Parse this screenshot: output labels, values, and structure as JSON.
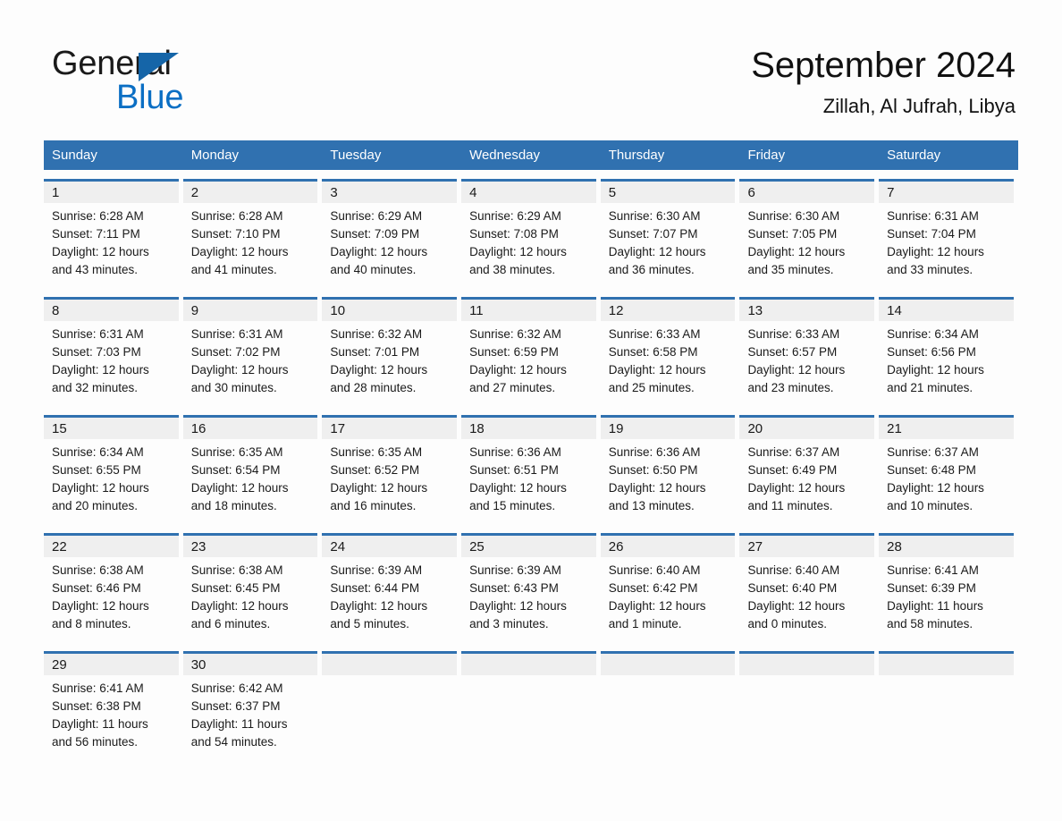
{
  "logo": {
    "word_general": "General",
    "word_blue": "Blue",
    "triangle_color": "#1565a8",
    "blue_text_color": "#0b6fc4"
  },
  "header": {
    "month_title": "September 2024",
    "location": "Zillah, Al Jufrah, Libya",
    "header_bg_color": "#3071b0",
    "day_band_color": "#efefef"
  },
  "weekdays": [
    "Sunday",
    "Monday",
    "Tuesday",
    "Wednesday",
    "Thursday",
    "Friday",
    "Saturday"
  ],
  "weeks": [
    [
      {
        "day": "1",
        "sunrise": "Sunrise: 6:28 AM",
        "sunset": "Sunset: 7:11 PM",
        "daylight_1": "Daylight: 12 hours",
        "daylight_2": "and 43 minutes."
      },
      {
        "day": "2",
        "sunrise": "Sunrise: 6:28 AM",
        "sunset": "Sunset: 7:10 PM",
        "daylight_1": "Daylight: 12 hours",
        "daylight_2": "and 41 minutes."
      },
      {
        "day": "3",
        "sunrise": "Sunrise: 6:29 AM",
        "sunset": "Sunset: 7:09 PM",
        "daylight_1": "Daylight: 12 hours",
        "daylight_2": "and 40 minutes."
      },
      {
        "day": "4",
        "sunrise": "Sunrise: 6:29 AM",
        "sunset": "Sunset: 7:08 PM",
        "daylight_1": "Daylight: 12 hours",
        "daylight_2": "and 38 minutes."
      },
      {
        "day": "5",
        "sunrise": "Sunrise: 6:30 AM",
        "sunset": "Sunset: 7:07 PM",
        "daylight_1": "Daylight: 12 hours",
        "daylight_2": "and 36 minutes."
      },
      {
        "day": "6",
        "sunrise": "Sunrise: 6:30 AM",
        "sunset": "Sunset: 7:05 PM",
        "daylight_1": "Daylight: 12 hours",
        "daylight_2": "and 35 minutes."
      },
      {
        "day": "7",
        "sunrise": "Sunrise: 6:31 AM",
        "sunset": "Sunset: 7:04 PM",
        "daylight_1": "Daylight: 12 hours",
        "daylight_2": "and 33 minutes."
      }
    ],
    [
      {
        "day": "8",
        "sunrise": "Sunrise: 6:31 AM",
        "sunset": "Sunset: 7:03 PM",
        "daylight_1": "Daylight: 12 hours",
        "daylight_2": "and 32 minutes."
      },
      {
        "day": "9",
        "sunrise": "Sunrise: 6:31 AM",
        "sunset": "Sunset: 7:02 PM",
        "daylight_1": "Daylight: 12 hours",
        "daylight_2": "and 30 minutes."
      },
      {
        "day": "10",
        "sunrise": "Sunrise: 6:32 AM",
        "sunset": "Sunset: 7:01 PM",
        "daylight_1": "Daylight: 12 hours",
        "daylight_2": "and 28 minutes."
      },
      {
        "day": "11",
        "sunrise": "Sunrise: 6:32 AM",
        "sunset": "Sunset: 6:59 PM",
        "daylight_1": "Daylight: 12 hours",
        "daylight_2": "and 27 minutes."
      },
      {
        "day": "12",
        "sunrise": "Sunrise: 6:33 AM",
        "sunset": "Sunset: 6:58 PM",
        "daylight_1": "Daylight: 12 hours",
        "daylight_2": "and 25 minutes."
      },
      {
        "day": "13",
        "sunrise": "Sunrise: 6:33 AM",
        "sunset": "Sunset: 6:57 PM",
        "daylight_1": "Daylight: 12 hours",
        "daylight_2": "and 23 minutes."
      },
      {
        "day": "14",
        "sunrise": "Sunrise: 6:34 AM",
        "sunset": "Sunset: 6:56 PM",
        "daylight_1": "Daylight: 12 hours",
        "daylight_2": "and 21 minutes."
      }
    ],
    [
      {
        "day": "15",
        "sunrise": "Sunrise: 6:34 AM",
        "sunset": "Sunset: 6:55 PM",
        "daylight_1": "Daylight: 12 hours",
        "daylight_2": "and 20 minutes."
      },
      {
        "day": "16",
        "sunrise": "Sunrise: 6:35 AM",
        "sunset": "Sunset: 6:54 PM",
        "daylight_1": "Daylight: 12 hours",
        "daylight_2": "and 18 minutes."
      },
      {
        "day": "17",
        "sunrise": "Sunrise: 6:35 AM",
        "sunset": "Sunset: 6:52 PM",
        "daylight_1": "Daylight: 12 hours",
        "daylight_2": "and 16 minutes."
      },
      {
        "day": "18",
        "sunrise": "Sunrise: 6:36 AM",
        "sunset": "Sunset: 6:51 PM",
        "daylight_1": "Daylight: 12 hours",
        "daylight_2": "and 15 minutes."
      },
      {
        "day": "19",
        "sunrise": "Sunrise: 6:36 AM",
        "sunset": "Sunset: 6:50 PM",
        "daylight_1": "Daylight: 12 hours",
        "daylight_2": "and 13 minutes."
      },
      {
        "day": "20",
        "sunrise": "Sunrise: 6:37 AM",
        "sunset": "Sunset: 6:49 PM",
        "daylight_1": "Daylight: 12 hours",
        "daylight_2": "and 11 minutes."
      },
      {
        "day": "21",
        "sunrise": "Sunrise: 6:37 AM",
        "sunset": "Sunset: 6:48 PM",
        "daylight_1": "Daylight: 12 hours",
        "daylight_2": "and 10 minutes."
      }
    ],
    [
      {
        "day": "22",
        "sunrise": "Sunrise: 6:38 AM",
        "sunset": "Sunset: 6:46 PM",
        "daylight_1": "Daylight: 12 hours",
        "daylight_2": "and 8 minutes."
      },
      {
        "day": "23",
        "sunrise": "Sunrise: 6:38 AM",
        "sunset": "Sunset: 6:45 PM",
        "daylight_1": "Daylight: 12 hours",
        "daylight_2": "and 6 minutes."
      },
      {
        "day": "24",
        "sunrise": "Sunrise: 6:39 AM",
        "sunset": "Sunset: 6:44 PM",
        "daylight_1": "Daylight: 12 hours",
        "daylight_2": "and 5 minutes."
      },
      {
        "day": "25",
        "sunrise": "Sunrise: 6:39 AM",
        "sunset": "Sunset: 6:43 PM",
        "daylight_1": "Daylight: 12 hours",
        "daylight_2": "and 3 minutes."
      },
      {
        "day": "26",
        "sunrise": "Sunrise: 6:40 AM",
        "sunset": "Sunset: 6:42 PM",
        "daylight_1": "Daylight: 12 hours",
        "daylight_2": "and 1 minute."
      },
      {
        "day": "27",
        "sunrise": "Sunrise: 6:40 AM",
        "sunset": "Sunset: 6:40 PM",
        "daylight_1": "Daylight: 12 hours",
        "daylight_2": "and 0 minutes."
      },
      {
        "day": "28",
        "sunrise": "Sunrise: 6:41 AM",
        "sunset": "Sunset: 6:39 PM",
        "daylight_1": "Daylight: 11 hours",
        "daylight_2": "and 58 minutes."
      }
    ],
    [
      {
        "day": "29",
        "sunrise": "Sunrise: 6:41 AM",
        "sunset": "Sunset: 6:38 PM",
        "daylight_1": "Daylight: 11 hours",
        "daylight_2": "and 56 minutes."
      },
      {
        "day": "30",
        "sunrise": "Sunrise: 6:42 AM",
        "sunset": "Sunset: 6:37 PM",
        "daylight_1": "Daylight: 11 hours",
        "daylight_2": "and 54 minutes."
      },
      {
        "day": "",
        "sunrise": "",
        "sunset": "",
        "daylight_1": "",
        "daylight_2": ""
      },
      {
        "day": "",
        "sunrise": "",
        "sunset": "",
        "daylight_1": "",
        "daylight_2": ""
      },
      {
        "day": "",
        "sunrise": "",
        "sunset": "",
        "daylight_1": "",
        "daylight_2": ""
      },
      {
        "day": "",
        "sunrise": "",
        "sunset": "",
        "daylight_1": "",
        "daylight_2": ""
      },
      {
        "day": "",
        "sunrise": "",
        "sunset": "",
        "daylight_1": "",
        "daylight_2": ""
      }
    ]
  ]
}
